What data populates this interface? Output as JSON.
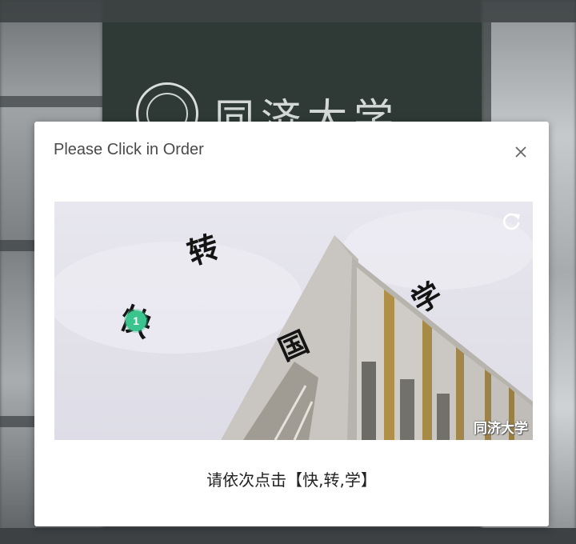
{
  "background": {
    "logo_text": "同济大学"
  },
  "modal": {
    "title": "Please Click in Order",
    "close_icon": "close-icon"
  },
  "captcha": {
    "refresh_icon": "refresh-icon",
    "watermark": "同济大学",
    "characters": [
      "转",
      "快",
      "学",
      "国"
    ],
    "click_markers": [
      "1"
    ]
  },
  "instruction": {
    "text": "请依次点击【快,转,学】"
  },
  "colors": {
    "marker": "#3cc48f",
    "modal_bg": "#ffffff"
  }
}
